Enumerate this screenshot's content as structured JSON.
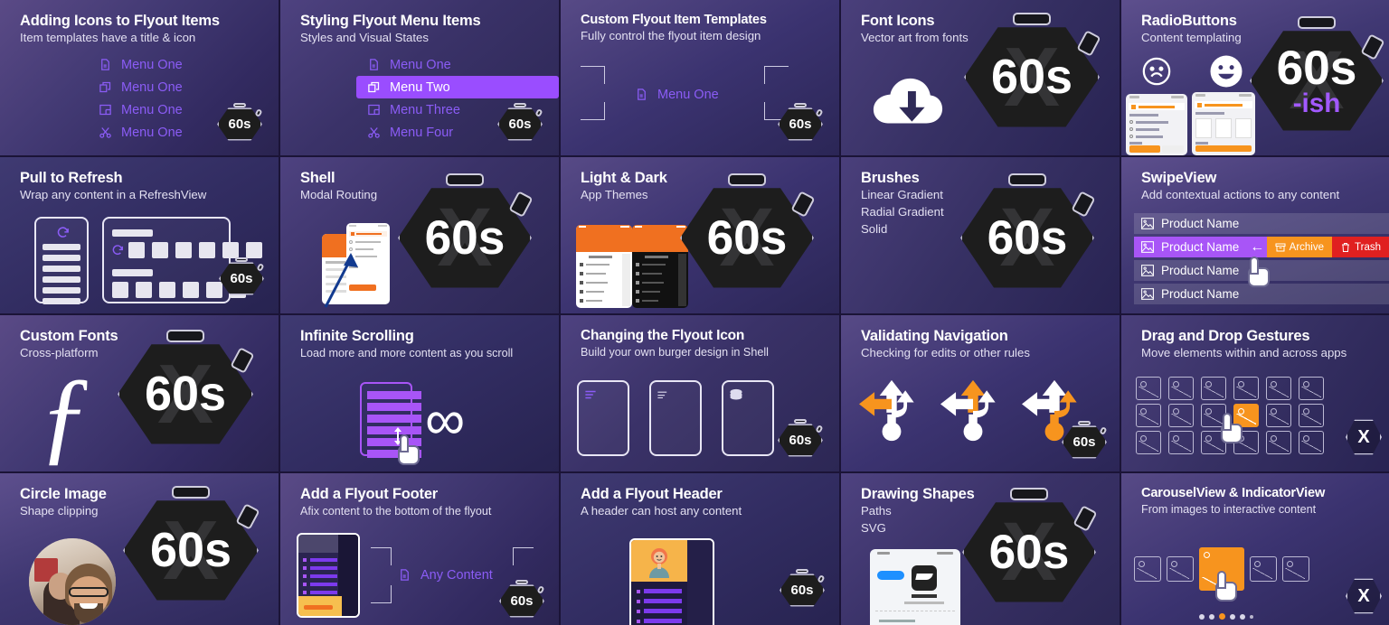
{
  "theme": {
    "accent_purple": "#8b5cf6",
    "accent_purple_bright": "#9a4dff",
    "accent_orange": "#f7941e",
    "danger_red": "#e02020",
    "badge_dark": "#1d1d1d",
    "background": "#2b2150"
  },
  "badge": {
    "label": "60s",
    "suffix": "-ish",
    "watermark": "X"
  },
  "cards": [
    {
      "title": "Adding Icons to Flyout Items",
      "subtitle": "Item templates have a title & icon",
      "menu_items": [
        {
          "label": "Menu One",
          "icon": "document-icon",
          "active": false
        },
        {
          "label": "Menu One",
          "icon": "copy-icon",
          "active": false
        },
        {
          "label": "Menu One",
          "icon": "layers-icon",
          "active": false
        },
        {
          "label": "Menu One",
          "icon": "scissors-icon",
          "active": false
        }
      ],
      "badge": "60s"
    },
    {
      "title": "Styling Flyout Menu Items",
      "subtitle": "Styles and Visual States",
      "menu_items": [
        {
          "label": "Menu One",
          "icon": "document-icon",
          "active": false
        },
        {
          "label": "Menu Two",
          "icon": "copy-icon",
          "active": true
        },
        {
          "label": "Menu Three",
          "icon": "layers-icon",
          "active": false
        },
        {
          "label": "Menu Four",
          "icon": "scissors-icon",
          "active": false
        }
      ],
      "badge": "60s"
    },
    {
      "title": "Custom Flyout Item Templates",
      "subtitle": "Fully control the flyout item design",
      "menu_items": [
        {
          "label": "Menu One",
          "icon": "document-icon",
          "active": false
        }
      ],
      "badge": "60s"
    },
    {
      "title": "Font Icons",
      "subtitle": "Vector art from fonts",
      "art": "cloud-download-icon",
      "badge": "60s"
    },
    {
      "title": "RadioButtons",
      "subtitle": "Content templating",
      "art": "sad-face-icon, happy-face-icon, two-phone-screenshots",
      "badge": "60s",
      "badge_suffix": "-ish"
    },
    {
      "title": "Pull to Refresh",
      "subtitle": "Wrap any content in a RefreshView",
      "art": "two-device-frames-with-refresh-icon",
      "badge": "60s"
    },
    {
      "title": "Shell",
      "subtitle": "Modal Routing",
      "art": "two-phone-screenshots-with-arrow",
      "badge": "60s"
    },
    {
      "title": "Light & Dark",
      "subtitle": "App Themes",
      "art": "light-and-dark-phone-screenshots",
      "badge": "60s"
    },
    {
      "title": "Brushes",
      "subtitle_lines": [
        "Linear Gradient",
        "Radial Gradient",
        "Solid"
      ],
      "badge": "60s"
    },
    {
      "title": "SwipeView",
      "subtitle": "Add contextual actions to any content",
      "rows": [
        {
          "label": "Product Name",
          "selected": false
        },
        {
          "label": "Product Name",
          "selected": true
        },
        {
          "label": "Product Name",
          "selected": false
        },
        {
          "label": "Product Name",
          "selected": false
        }
      ],
      "actions": [
        {
          "label": "Archive",
          "icon": "archive-icon",
          "color": "#f7941e"
        },
        {
          "label": "Trash",
          "icon": "trash-icon",
          "color": "#e02020"
        }
      ]
    },
    {
      "title": "Custom Fonts",
      "subtitle": "Cross-platform",
      "art": "script-f-glyph",
      "badge": "60s"
    },
    {
      "title": "Infinite Scrolling",
      "subtitle": "Load more and more content as you scroll",
      "art": "scrolling-list-with-infinity-symbol",
      "infinity_glyph": "∞"
    },
    {
      "title": "Changing the Flyout Icon",
      "subtitle": "Build your own burger design in Shell",
      "art": "three-device-frames-with-burger-icons",
      "badge": "60s"
    },
    {
      "title": "Validating Navigation",
      "subtitle": "Checking for edits or other rules",
      "art": "three-direction-arrow-clusters",
      "badge": "60s"
    },
    {
      "title": "Drag and Drop Gestures",
      "subtitle": "Move elements within and across apps",
      "art": "image-grid-with-dragged-tile",
      "logo": "X"
    },
    {
      "title": "Circle Image",
      "subtitle": "Shape clipping",
      "art": "circular-profile-photo",
      "badge": "60s"
    },
    {
      "title": "Add a Flyout Footer",
      "subtitle": "Afix content to the bottom of the flyout",
      "placeholder_label": "Any Content",
      "placeholder_icon": "document-icon",
      "badge": "60s"
    },
    {
      "title": "Add a Flyout Header",
      "subtitle": "A header can host any content",
      "art": "flyout-with-avatar-header",
      "badge": "60s"
    },
    {
      "title": "Drawing Shapes",
      "subtitle_lines": [
        "Paths",
        "SVG"
      ],
      "art": "phone-screenshot-receipt",
      "badge": "60s"
    },
    {
      "title": "CarouselView & IndicatorView",
      "subtitle": "From images to interactive content",
      "art": "carousel-with-indicator-dots",
      "indicator_count": 6,
      "indicator_active_index": 2,
      "logo": "X"
    }
  ]
}
